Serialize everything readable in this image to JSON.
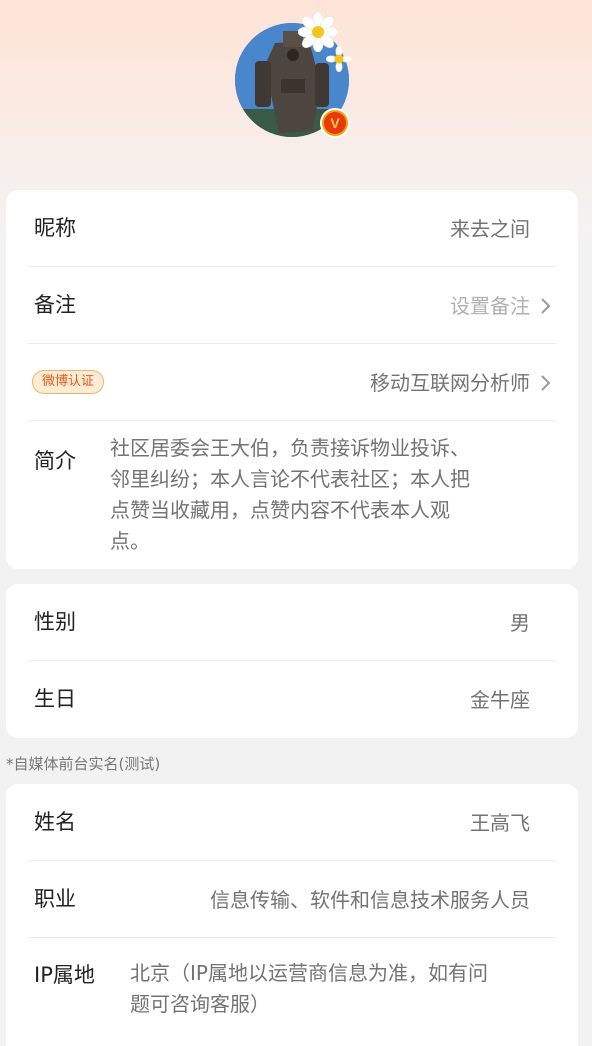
{
  "avatar": {
    "badge_glyph": "V",
    "badge_color": "#e8380d"
  },
  "basic": {
    "nickname_label": "昵称",
    "nickname_value": "来去之间",
    "remark_label": "备注",
    "remark_value": "设置备注",
    "verify_badge": "微博认证",
    "verify_value": "移动互联网分析师",
    "bio_label": "简介",
    "bio_value": "社区居委会王大伯，负责接诉物业投诉、\n邻里纠纷；本人言论不代表社区；本人把\n点赞当收藏用，点赞内容不代表本人观\n点。"
  },
  "personal": {
    "gender_label": "性别",
    "gender_value": "男",
    "birthday_label": "生日",
    "birthday_value": "金牛座"
  },
  "section_note": "*自媒体前台实名(测试)",
  "realname": {
    "name_label": "姓名",
    "name_value": "王高飞",
    "job_label": "职业",
    "job_value": "信息传输、软件和信息技术服务人员",
    "ip_label": "IP属地",
    "ip_value": "北京（IP属地以运营商信息为准，如有问\n题可咨询客服）"
  }
}
